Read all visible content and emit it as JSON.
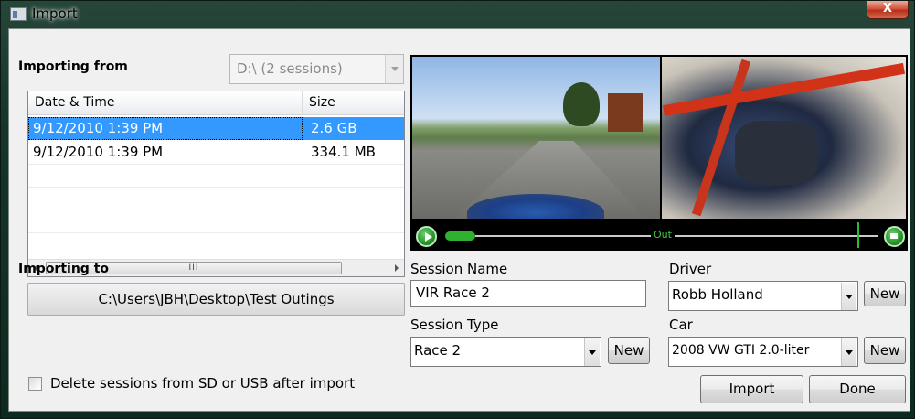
{
  "window": {
    "title": "Import",
    "close_label": "X"
  },
  "importing_from": {
    "label": "Importing from",
    "source_value": "D:\\ (2 sessions)"
  },
  "session_list": {
    "columns": [
      "Date & Time",
      "Size"
    ],
    "rows": [
      {
        "datetime": "9/12/2010  1:39 PM",
        "size": "2.6 GB",
        "selected": true
      },
      {
        "datetime": "9/12/2010  1:39 PM",
        "size": "334.1 MB",
        "selected": false
      }
    ],
    "scroll_thumb_grip": "III"
  },
  "importing_to": {
    "label": "Importing to",
    "path": "C:\\Users\\JBH\\Desktop\\Test Outings"
  },
  "delete_option": {
    "label": "Delete sessions from SD or USB after import",
    "checked": false
  },
  "video": {
    "out_label": "Out"
  },
  "form": {
    "session_name_label": "Session Name",
    "session_name_value": "VIR Race 2",
    "driver_label": "Driver",
    "driver_value": "Robb Holland",
    "driver_new": "New",
    "session_type_label": "Session Type",
    "session_type_value": "Race 2",
    "session_type_new": "New",
    "car_label": "Car",
    "car_value": "2008 VW GTI 2.0-liter",
    "car_new": "New"
  },
  "actions": {
    "import": "Import",
    "done": "Done"
  },
  "colors": {
    "selection": "#3399ff",
    "video_accent": "#2bbd2b"
  }
}
